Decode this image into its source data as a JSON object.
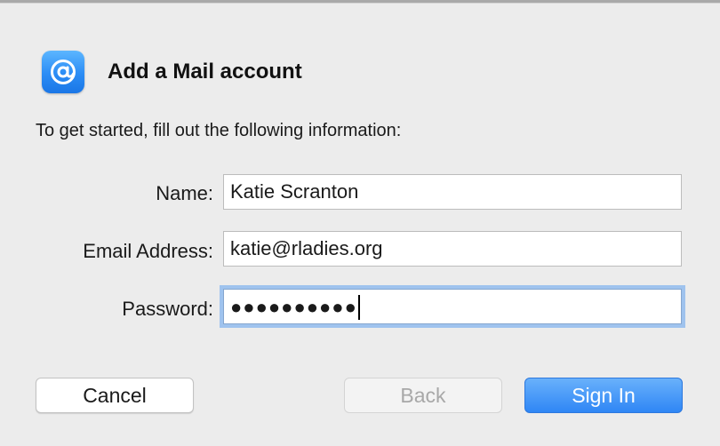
{
  "dialog": {
    "title": "Add a Mail account",
    "intro": "To get started, fill out the following information:",
    "icon": "at-sign-icon"
  },
  "form": {
    "name_label": "Name:",
    "name_value": "Katie Scranton",
    "email_label": "Email Address:",
    "email_value": "katie@rladies.org",
    "password_label": "Password:",
    "password_masked": "●●●●●●●●●●"
  },
  "buttons": {
    "cancel": "Cancel",
    "back": "Back",
    "sign_in": "Sign In"
  },
  "colors": {
    "accent": "#2f86f5",
    "focus_ring": "#9fc3ee",
    "window_bg": "#ececec"
  }
}
